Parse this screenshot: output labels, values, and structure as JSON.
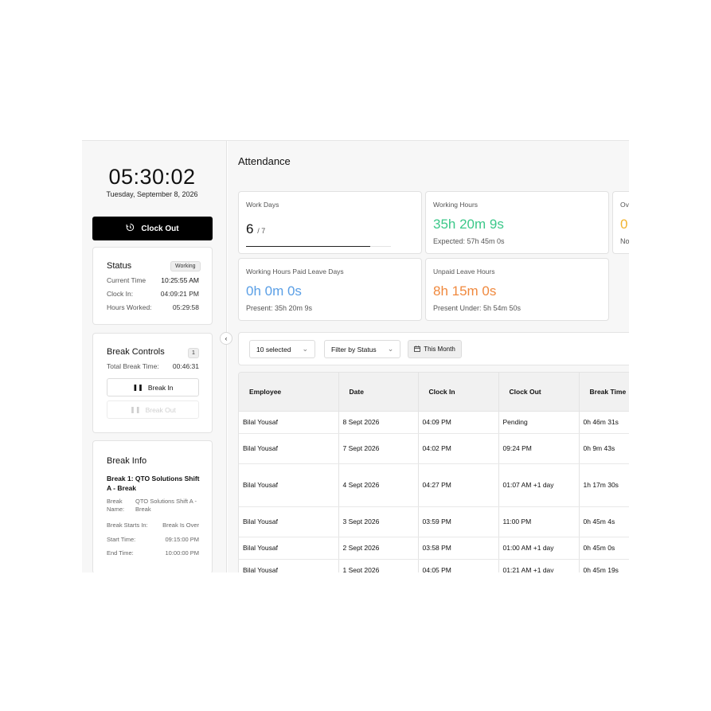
{
  "sidebar": {
    "time": "05:30:02",
    "date": "Tuesday, September 8, 2026",
    "clock_out_label": "Clock Out",
    "status": {
      "title": "Status",
      "badge": "Working",
      "rows": [
        {
          "label": "Current Time",
          "value": "10:25:55 AM"
        },
        {
          "label": "Clock In:",
          "value": "04:09:21 PM"
        },
        {
          "label": "Hours Worked:",
          "value": "05:29:58"
        }
      ]
    },
    "break_controls": {
      "title": "Break Controls",
      "count": "1",
      "total_label": "Total Break Time:",
      "total_value": "00:46:31",
      "break_in_label": "Break In",
      "break_out_label": "Break Out"
    },
    "break_info": {
      "title": "Break Info",
      "subtitle": "Break 1: QTO Solutions Shift A - Break",
      "name_label": "Break Name:",
      "name_value": "QTO Solutions Shift A - Break",
      "starts_label": "Break Starts In:",
      "starts_value": "Break Is Over",
      "start_label": "Start Time:",
      "start_value": "09:15:00 PM",
      "end_label": "End Time:",
      "end_value": "10:00:00 PM"
    }
  },
  "main": {
    "title": "Attendance",
    "stats": {
      "work_days": {
        "label": "Work Days",
        "value": "6",
        "total": "/ 7",
        "progress": 0.857
      },
      "working_hours": {
        "label": "Working Hours",
        "value": "35h 20m 9s",
        "sub": "Expected: 57h 45m 0s"
      },
      "overtime": {
        "label": "Ov",
        "value": "0",
        "sub": "No"
      },
      "paid_leave": {
        "label": "Working Hours Paid Leave Days",
        "value": "0h 0m 0s",
        "sub": "Present: 35h 20m 9s"
      },
      "unpaid_leave": {
        "label": "Unpaid Leave Hours",
        "value": "8h 15m 0s",
        "sub": "Present Under: 5h 54m 50s"
      }
    },
    "filters": {
      "selected": "10 selected",
      "status": "Filter by Status",
      "month": "This Month"
    },
    "table": {
      "headers": [
        "Employee",
        "Date",
        "Clock In",
        "Clock Out",
        "Break Time"
      ],
      "rows": [
        [
          "Bilal Yousaf",
          "8 Sept 2026",
          "04:09 PM",
          "Pending",
          "0h 46m 31s"
        ],
        [
          "Bilal Yousaf",
          "7 Sept 2026",
          "04:02 PM",
          "09:24 PM",
          "0h 9m 43s"
        ],
        [
          "Bilal Yousaf",
          "4 Sept 2026",
          "04:27 PM",
          "01:07 AM +1 day",
          "1h 17m 30s"
        ],
        [
          "Bilal Yousaf",
          "3 Sept 2026",
          "03:59 PM",
          "11:00 PM",
          "0h 45m 4s"
        ],
        [
          "Bilal Yousaf",
          "2 Sept 2026",
          "03:58 PM",
          "01:00 AM +1 day",
          "0h 45m 0s"
        ],
        [
          "Bilal Yousaf",
          "1 Sept 2026",
          "04:05 PM",
          "01:21 AM +1 day",
          "0h 45m 19s"
        ]
      ]
    }
  },
  "colors": {
    "positive": "#3cc88a",
    "info": "#5a9fe6",
    "warning": "#f0893e",
    "overtime": "#f2b431"
  }
}
